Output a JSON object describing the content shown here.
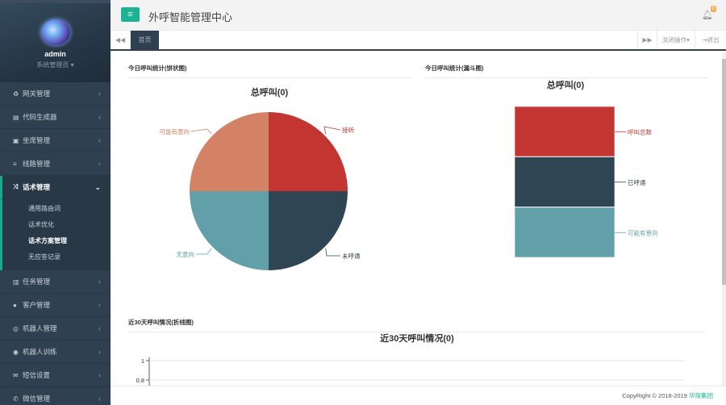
{
  "app": {
    "title": "外呼智能管理中心",
    "notification_count": "0"
  },
  "profile": {
    "name": "admin",
    "role": "系统管理员"
  },
  "menu": [
    {
      "label": "网关管理",
      "icon": "gateway-icon",
      "glyph": "♻"
    },
    {
      "label": "代码生成器",
      "icon": "code-icon",
      "glyph": "▤"
    },
    {
      "label": "坐席管理",
      "icon": "calendar-icon",
      "glyph": "▣"
    },
    {
      "label": "线路管理",
      "icon": "list-icon",
      "glyph": "≡"
    },
    {
      "label": "话术管理",
      "icon": "shuffle-icon",
      "glyph": "⤨"
    },
    {
      "label": "任务管理",
      "icon": "map-icon",
      "glyph": "▥"
    },
    {
      "label": "客户管理",
      "icon": "user-icon",
      "glyph": "●"
    },
    {
      "label": "机器人管理",
      "icon": "robot-icon",
      "glyph": "◎"
    },
    {
      "label": "机器人训练",
      "icon": "training-icon",
      "glyph": "◉"
    },
    {
      "label": "短信设置",
      "icon": "sms-icon",
      "glyph": "✉"
    },
    {
      "label": "微信管理",
      "icon": "wechat-icon",
      "glyph": "✆"
    }
  ],
  "submenu": [
    {
      "label": "通用路由词"
    },
    {
      "label": "话术优化"
    },
    {
      "label": "话术方案管理"
    },
    {
      "label": "无应答记录"
    }
  ],
  "tabs": {
    "home": "首页",
    "close_ops": "关闭操作",
    "exit": "退出"
  },
  "panels": {
    "pie_panel": "今日呼叫统计(饼状图)",
    "funnel_panel": "今日呼叫统计(漏斗图)",
    "line_panel": "近30天呼叫情况(折线图)"
  },
  "footer": {
    "copyright": "CopyRight © 2018-2019",
    "brand": "华琛集团"
  },
  "chart_data": [
    {
      "type": "pie",
      "title": "总呼叫(0)",
      "categories": [
        "接听",
        "未呼通",
        "无意向",
        "可能有意向"
      ],
      "values": [
        0,
        0,
        0,
        0
      ],
      "colors": [
        "#c23531",
        "#2f4554",
        "#61a0a8",
        "#d48265"
      ]
    },
    {
      "type": "bar",
      "title": "总呼叫(0)",
      "categories": [
        "呼叫总数",
        "已呼通",
        "可能有意向"
      ],
      "values": [
        0,
        0,
        0
      ],
      "colors": [
        "#c23531",
        "#2f4554",
        "#61a0a8"
      ]
    },
    {
      "type": "line",
      "title": "近30天呼叫情况(0)",
      "yticks": [
        "1",
        "0.8"
      ],
      "ylim": [
        0,
        1
      ]
    }
  ]
}
